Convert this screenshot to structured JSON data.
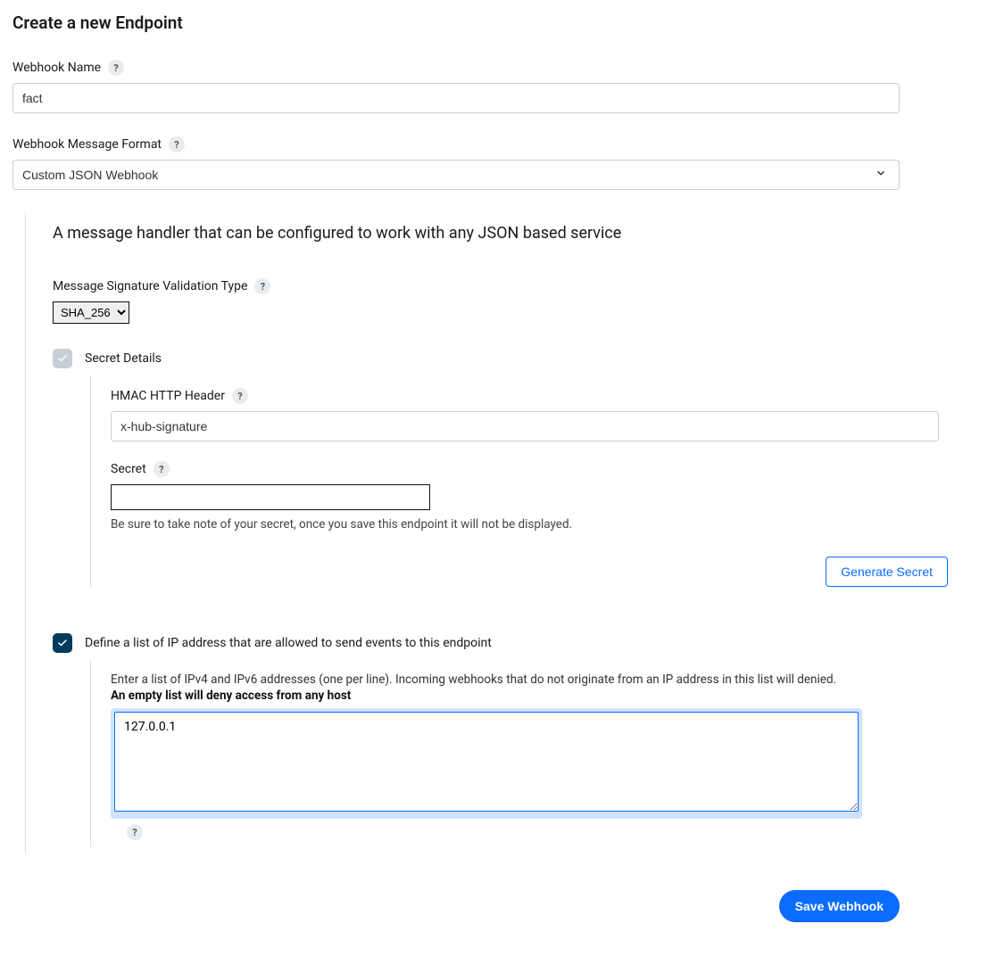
{
  "page": {
    "title": "Create a new Endpoint"
  },
  "webhookName": {
    "label": "Webhook Name",
    "value": "fact"
  },
  "messageFormat": {
    "label": "Webhook Message Format",
    "value": "Custom JSON Webhook"
  },
  "handler": {
    "description": "A message handler that can be configured to work with any JSON based service",
    "signatureType": {
      "label": "Message Signature Validation Type",
      "value": "SHA_256"
    },
    "secretDetails": {
      "toggleLabel": "Secret Details",
      "hmacHeader": {
        "label": "HMAC HTTP Header",
        "value": "x-hub-signature"
      },
      "secret": {
        "label": "Secret",
        "value": "",
        "hint": "Be sure to take note of your secret, once you save this endpoint it will not be displayed.",
        "generateLabel": "Generate Secret"
      }
    },
    "ipAllow": {
      "toggleLabel": "Define a list of IP address that are allowed to send events to this endpoint",
      "description": "Enter a list of IPv4 and IPv6 addresses (one per line). Incoming webhooks that do not originate from an IP address in this list will denied.",
      "warning": "An empty list will deny access from any host",
      "value": "127.0.0.1"
    }
  },
  "actions": {
    "save": "Save Webhook"
  }
}
